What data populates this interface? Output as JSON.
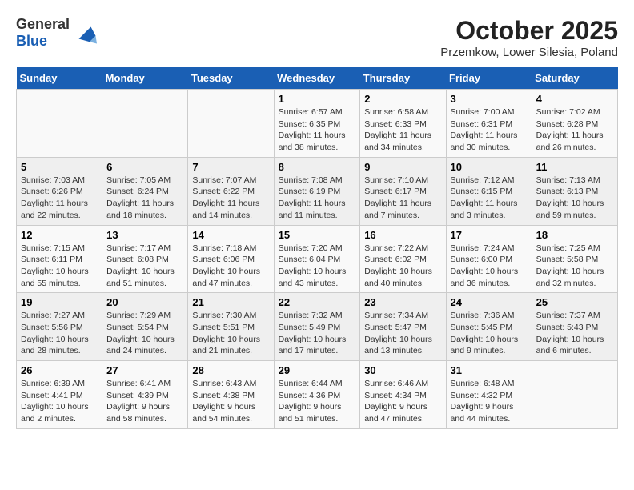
{
  "header": {
    "logo_general": "General",
    "logo_blue": "Blue",
    "title": "October 2025",
    "subtitle": "Przemkow, Lower Silesia, Poland"
  },
  "days_of_week": [
    "Sunday",
    "Monday",
    "Tuesday",
    "Wednesday",
    "Thursday",
    "Friday",
    "Saturday"
  ],
  "weeks": [
    [
      {
        "day": "",
        "info": ""
      },
      {
        "day": "",
        "info": ""
      },
      {
        "day": "",
        "info": ""
      },
      {
        "day": "1",
        "info": "Sunrise: 6:57 AM\nSunset: 6:35 PM\nDaylight: 11 hours\nand 38 minutes."
      },
      {
        "day": "2",
        "info": "Sunrise: 6:58 AM\nSunset: 6:33 PM\nDaylight: 11 hours\nand 34 minutes."
      },
      {
        "day": "3",
        "info": "Sunrise: 7:00 AM\nSunset: 6:31 PM\nDaylight: 11 hours\nand 30 minutes."
      },
      {
        "day": "4",
        "info": "Sunrise: 7:02 AM\nSunset: 6:28 PM\nDaylight: 11 hours\nand 26 minutes."
      }
    ],
    [
      {
        "day": "5",
        "info": "Sunrise: 7:03 AM\nSunset: 6:26 PM\nDaylight: 11 hours\nand 22 minutes."
      },
      {
        "day": "6",
        "info": "Sunrise: 7:05 AM\nSunset: 6:24 PM\nDaylight: 11 hours\nand 18 minutes."
      },
      {
        "day": "7",
        "info": "Sunrise: 7:07 AM\nSunset: 6:22 PM\nDaylight: 11 hours\nand 14 minutes."
      },
      {
        "day": "8",
        "info": "Sunrise: 7:08 AM\nSunset: 6:19 PM\nDaylight: 11 hours\nand 11 minutes."
      },
      {
        "day": "9",
        "info": "Sunrise: 7:10 AM\nSunset: 6:17 PM\nDaylight: 11 hours\nand 7 minutes."
      },
      {
        "day": "10",
        "info": "Sunrise: 7:12 AM\nSunset: 6:15 PM\nDaylight: 11 hours\nand 3 minutes."
      },
      {
        "day": "11",
        "info": "Sunrise: 7:13 AM\nSunset: 6:13 PM\nDaylight: 10 hours\nand 59 minutes."
      }
    ],
    [
      {
        "day": "12",
        "info": "Sunrise: 7:15 AM\nSunset: 6:11 PM\nDaylight: 10 hours\nand 55 minutes."
      },
      {
        "day": "13",
        "info": "Sunrise: 7:17 AM\nSunset: 6:08 PM\nDaylight: 10 hours\nand 51 minutes."
      },
      {
        "day": "14",
        "info": "Sunrise: 7:18 AM\nSunset: 6:06 PM\nDaylight: 10 hours\nand 47 minutes."
      },
      {
        "day": "15",
        "info": "Sunrise: 7:20 AM\nSunset: 6:04 PM\nDaylight: 10 hours\nand 43 minutes."
      },
      {
        "day": "16",
        "info": "Sunrise: 7:22 AM\nSunset: 6:02 PM\nDaylight: 10 hours\nand 40 minutes."
      },
      {
        "day": "17",
        "info": "Sunrise: 7:24 AM\nSunset: 6:00 PM\nDaylight: 10 hours\nand 36 minutes."
      },
      {
        "day": "18",
        "info": "Sunrise: 7:25 AM\nSunset: 5:58 PM\nDaylight: 10 hours\nand 32 minutes."
      }
    ],
    [
      {
        "day": "19",
        "info": "Sunrise: 7:27 AM\nSunset: 5:56 PM\nDaylight: 10 hours\nand 28 minutes."
      },
      {
        "day": "20",
        "info": "Sunrise: 7:29 AM\nSunset: 5:54 PM\nDaylight: 10 hours\nand 24 minutes."
      },
      {
        "day": "21",
        "info": "Sunrise: 7:30 AM\nSunset: 5:51 PM\nDaylight: 10 hours\nand 21 minutes."
      },
      {
        "day": "22",
        "info": "Sunrise: 7:32 AM\nSunset: 5:49 PM\nDaylight: 10 hours\nand 17 minutes."
      },
      {
        "day": "23",
        "info": "Sunrise: 7:34 AM\nSunset: 5:47 PM\nDaylight: 10 hours\nand 13 minutes."
      },
      {
        "day": "24",
        "info": "Sunrise: 7:36 AM\nSunset: 5:45 PM\nDaylight: 10 hours\nand 9 minutes."
      },
      {
        "day": "25",
        "info": "Sunrise: 7:37 AM\nSunset: 5:43 PM\nDaylight: 10 hours\nand 6 minutes."
      }
    ],
    [
      {
        "day": "26",
        "info": "Sunrise: 6:39 AM\nSunset: 4:41 PM\nDaylight: 10 hours\nand 2 minutes."
      },
      {
        "day": "27",
        "info": "Sunrise: 6:41 AM\nSunset: 4:39 PM\nDaylight: 9 hours\nand 58 minutes."
      },
      {
        "day": "28",
        "info": "Sunrise: 6:43 AM\nSunset: 4:38 PM\nDaylight: 9 hours\nand 54 minutes."
      },
      {
        "day": "29",
        "info": "Sunrise: 6:44 AM\nSunset: 4:36 PM\nDaylight: 9 hours\nand 51 minutes."
      },
      {
        "day": "30",
        "info": "Sunrise: 6:46 AM\nSunset: 4:34 PM\nDaylight: 9 hours\nand 47 minutes."
      },
      {
        "day": "31",
        "info": "Sunrise: 6:48 AM\nSunset: 4:32 PM\nDaylight: 9 hours\nand 44 minutes."
      },
      {
        "day": "",
        "info": ""
      }
    ]
  ]
}
